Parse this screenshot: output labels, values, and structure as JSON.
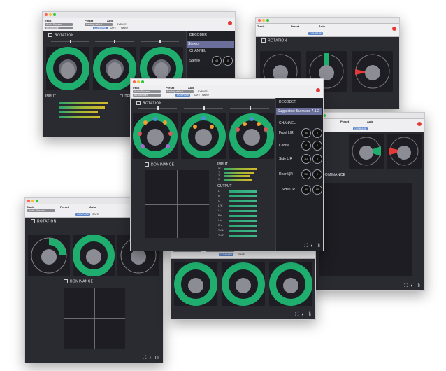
{
  "header": {
    "track_label": "Track",
    "preset_label": "Preset",
    "auto_label": "Auto",
    "track_value": "Audio Streams",
    "preset_value": "Factory default",
    "compare_label": "COMPARE",
    "safe_label": "SAFE",
    "native_label": "Native",
    "bypass_label": "BYPASS",
    "insert_label": "a/c Decoder"
  },
  "sections": {
    "rotation": "ROTATION",
    "dominance": "DOMINANCE",
    "decoder": "DECODER",
    "input": "INPUT",
    "output": "OUTPUT",
    "channel": "CHANNEL"
  },
  "decoder_back": {
    "mode": "Stereo",
    "channel_row": "Stereo",
    "knob_a": "45",
    "knob_b": "0"
  },
  "decoder_front": {
    "suggested": "Suggested: Surround 7.1.2",
    "rows": [
      {
        "label": "Front L|R",
        "a": "30",
        "b": "0"
      },
      {
        "label": "Centre",
        "a": "0",
        "b": "0"
      },
      {
        "label": "Side L|R",
        "a": "110",
        "b": "0"
      },
      {
        "label": "Rear L|R",
        "a": "150",
        "b": "0"
      },
      {
        "label": "T.Side L|R",
        "a": "90",
        "b": "65"
      }
    ]
  },
  "input_channels": [
    "W",
    "Y",
    "Z",
    "X"
  ],
  "input_levels": [
    0.8,
    0.74,
    0.64,
    0.66
  ],
  "output_channels": [
    "L",
    "R",
    "C",
    "LFE",
    "Ls",
    "Rss",
    "Lrs",
    "Rrs",
    "TpSL",
    "TpSR"
  ],
  "output_levels": [
    0.5,
    0.5,
    0.5,
    0.5,
    0.5,
    0.5,
    0.5,
    0.5,
    0.5,
    0.5
  ],
  "colors": {
    "accent_green": "#1fae6e",
    "compare_blue": "#5c84c8",
    "bypass_red": "#e53935",
    "suggest_purple": "#6a6f9c"
  }
}
